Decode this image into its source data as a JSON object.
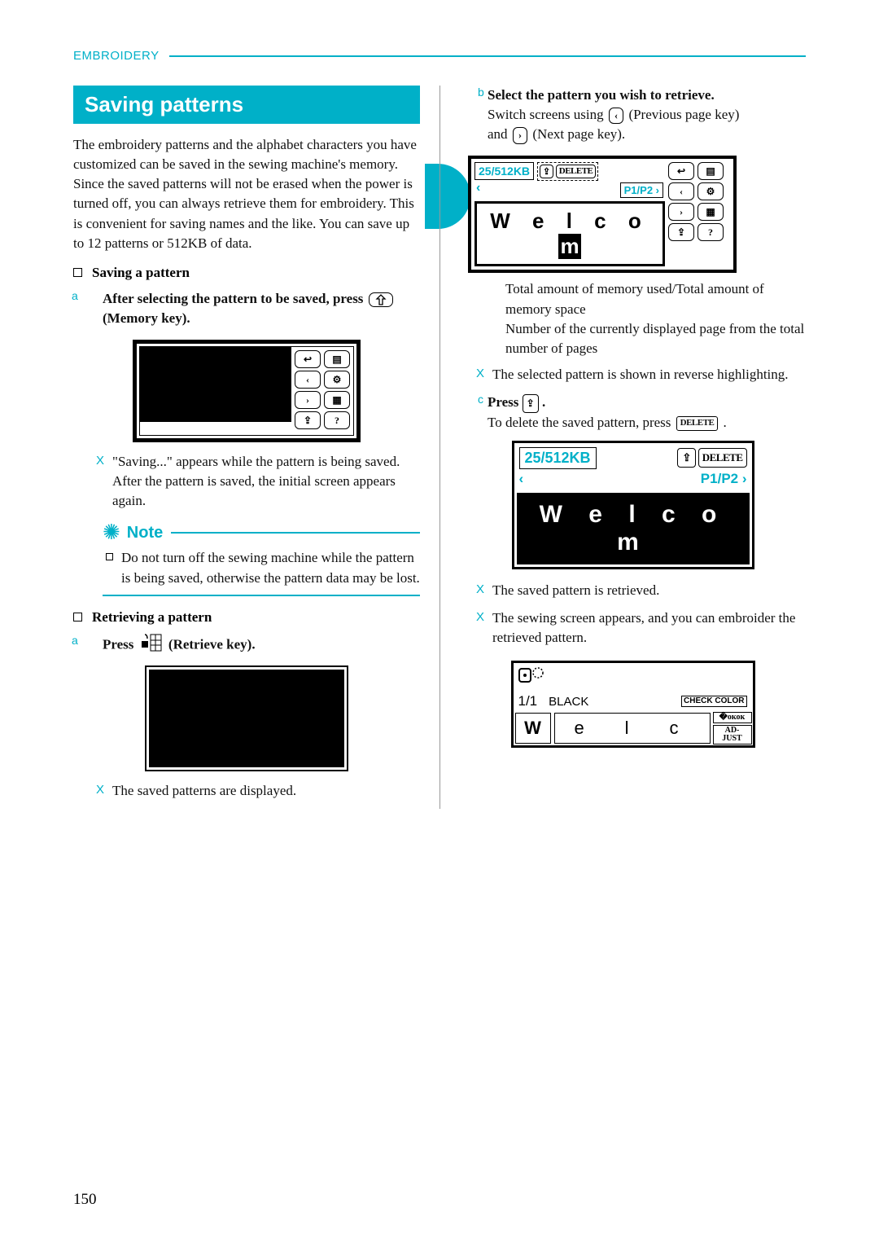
{
  "header": {
    "section": "EMBROIDERY"
  },
  "title": "Saving patterns",
  "intro": "The embroidery patterns and the alphabet characters you have customized can be saved in the sewing machine's memory.\nSince the saved patterns will not be erased when the power is turned off, you can always retrieve them for embroidery. This is convenient for saving names and the like. You can save up to 12 patterns or 512KB of data.",
  "saving": {
    "heading": "Saving a pattern",
    "step_a_marker": "a",
    "step_a": "After selecting the pattern to be saved, press",
    "step_a_key": "(Memory key).",
    "result": "\"Saving...\" appears while the pattern is being saved. After the pattern is saved, the initial screen appears again.",
    "note_label": "Note",
    "note_body": "Do not turn off the sewing machine while the pattern is being saved, otherwise the pattern data may be lost."
  },
  "retrieving": {
    "heading": "Retrieving a pattern",
    "step_a_marker": "a",
    "step_a_pre": "Press",
    "step_a_key": "(Retrieve key).",
    "result": "The saved patterns are displayed."
  },
  "right": {
    "step_b_marker": "b",
    "step_b_title": "Select the pattern you wish to retrieve.",
    "step_b_line1a": "Switch screens using",
    "step_b_line1b": "(Previous page key)",
    "step_b_line2a": "and",
    "step_b_line2b": "(Next page key).",
    "screen1": {
      "mem": "25/512KB",
      "delete": "DELETE",
      "page": "P1/P2 ›",
      "text": "W e l c o m",
      "text_inv": "m"
    },
    "legend1": "Total amount of memory used/Total amount of memory space",
    "legend2": "Number of the currently displayed page from the total number of pages",
    "result_b": "The selected pattern is shown in reverse highlighting.",
    "step_c_marker": "c",
    "step_c_pre": "Press",
    "step_c_post": ".",
    "step_c_line": "To delete the saved pattern, press",
    "screen2": {
      "mem": "25/512KB",
      "delete": "DELETE",
      "prev": "‹",
      "page": "P1/P2 ›",
      "text": "W e l c o m"
    },
    "result_c1": "The saved pattern is retrieved.",
    "result_c2": "The sewing screen appears, and you can embroider the retrieved pattern.",
    "screen3": {
      "count": "1/1",
      "color": "BLACK",
      "chk": "CHECK COLOR",
      "adj": "AD-JUST",
      "letters": [
        "W",
        "e",
        "l",
        "c"
      ]
    }
  },
  "icons": {
    "back": "↩",
    "prev": "‹",
    "next": "›",
    "mem": "⇪",
    "gear": "⚙",
    "panel": "▤",
    "page": "▦",
    "foot": "▢",
    "delete_small": "DELETE"
  },
  "page_number": "150"
}
